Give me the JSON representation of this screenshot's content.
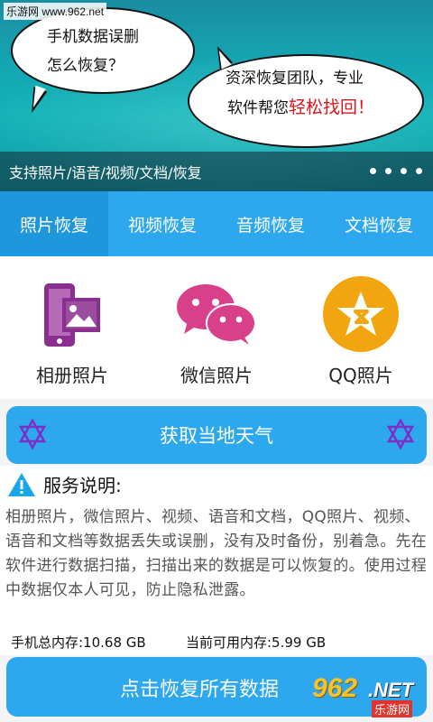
{
  "banner": {
    "site_watermark": "乐游网 www.962.net",
    "bubble_left_line1": "手机数据误删",
    "bubble_left_line2": "怎么恢复？",
    "bubble_right_line1": "资深恢复团队，专业",
    "bubble_right_line2_prefix": "软件帮您",
    "bubble_right_line2_highlight": "轻松找回！",
    "caption": "支持照片/语音/视频/文档/恢复",
    "dot_count": 4
  },
  "tabs": [
    {
      "label": "照片恢复",
      "active": true
    },
    {
      "label": "视频恢复",
      "active": false
    },
    {
      "label": "音频恢复",
      "active": false
    },
    {
      "label": "文档恢复",
      "active": false
    }
  ],
  "categories": [
    {
      "label": "相册照片",
      "icon": "photo-album-icon"
    },
    {
      "label": "微信照片",
      "icon": "wechat-icon"
    },
    {
      "label": "QQ照片",
      "icon": "qq-star-icon"
    }
  ],
  "weather_button": {
    "label": "获取当地天气"
  },
  "service": {
    "title": "服务说明:",
    "text": "相册照片，微信照片、视频、语音和文档，QQ照片、视频、语音和文档等数据丢失或误删，没有及时备份，别着急。先在软件进行数据扫描，扫描出来的数据是可以恢复的。使用过程中数据仅本人可见，防止隐私泄露。"
  },
  "memory": {
    "total": "手机总内存:10.68 GB",
    "available": "当前可用内存:5.99 GB"
  },
  "recover_button": {
    "label": "点击恢复所有数据"
  },
  "watermark_bottom": {
    "number": "962",
    "net": ".NET",
    "cn": "乐游网"
  },
  "colors": {
    "primary": "#2da8ef",
    "primary_dark": "#1f97dc",
    "highlight_red": "#e0161c",
    "icon_purple": "#8a2e8f",
    "icon_pink": "#d8418a",
    "icon_yellow": "#f1a50e",
    "star_purple": "#7b2fc9"
  }
}
